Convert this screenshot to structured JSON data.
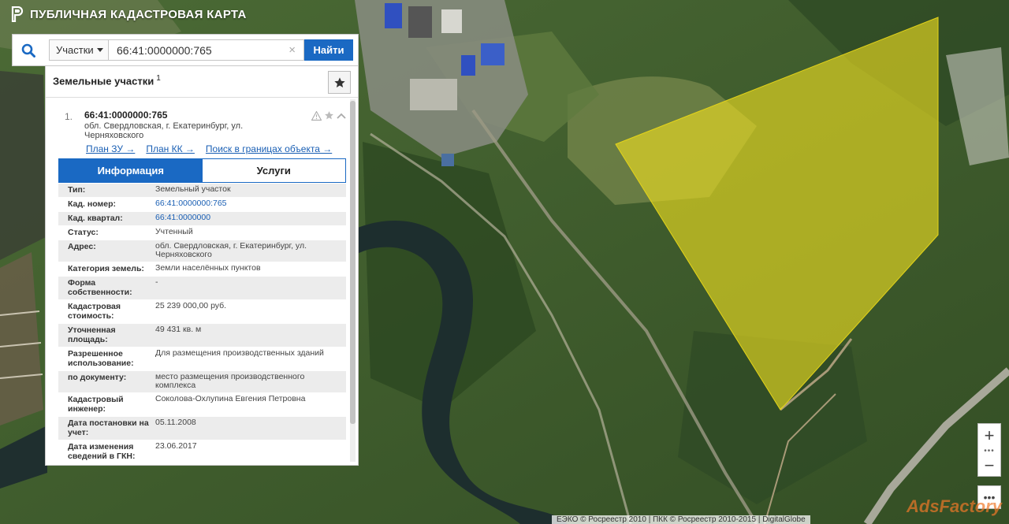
{
  "app": {
    "title": "ПУБЛИЧНАЯ КАДАСТРОВАЯ КАРТА"
  },
  "search": {
    "type_label": "Участки",
    "query": "66:41:0000000:765",
    "clear_symbol": "×",
    "find_label": "Найти"
  },
  "panel": {
    "title": "Земельные участки",
    "count": "1"
  },
  "result": {
    "index": "1.",
    "cad_number": "66:41:0000000:765",
    "address": "обл. Свердловская, г. Екатеринбург, ул. Черняховского",
    "links": [
      "План ЗУ →",
      "План КК →",
      "Поиск в границах объекта →"
    ]
  },
  "tabs": {
    "info": "Информация",
    "services": "Услуги"
  },
  "info_rows": [
    {
      "k": "Тип:",
      "v": "Земельный участок"
    },
    {
      "k": "Кад. номер:",
      "v": "66:41:0000000:765"
    },
    {
      "k": "Кад. квартал:",
      "v": "66:41:0000000"
    },
    {
      "k": "Статус:",
      "v": "Учтенный"
    },
    {
      "k": "Адрес:",
      "v": "обл. Свердловская, г. Екатеринбург, ул. Черняховского"
    },
    {
      "k": "Категория земель:",
      "v": "Земли населённых пунктов"
    },
    {
      "k": "Форма собственности:",
      "v": "-"
    },
    {
      "k": "Кадастровая стоимость:",
      "v": "25 239 000,00 руб."
    },
    {
      "k": "Уточненная площадь:",
      "v": "49 431 кв. м"
    },
    {
      "k": "Разрешенное использование:",
      "v": "Для размещения производственных зданий"
    },
    {
      "k": "по документу:",
      "v": "место размещения производственного комплекса"
    },
    {
      "k": "Кадастровый инженер:",
      "v": "Соколова-Охлупина Евгения Петровна"
    },
    {
      "k": "Дата постановки на учет:",
      "v": "05.11.2008"
    },
    {
      "k": "Дата изменения сведений в ГКН:",
      "v": "23.06.2017"
    }
  ],
  "controls": {
    "zoom_in": "+",
    "zoom_out": "−",
    "more": "•••"
  },
  "attribution": "ЕЭКО © Росреестр 2010 | ПКК © Росреестр 2010-2015 | DigitalGlobe",
  "watermark": "AdsFactory",
  "colors": {
    "accent": "#1a69c3",
    "parcel": "#f0e020",
    "link": "#1a5fb4"
  },
  "icons": [
    "logo-icon",
    "search-icon",
    "star-icon",
    "warning-icon",
    "chevron-up-icon"
  ]
}
